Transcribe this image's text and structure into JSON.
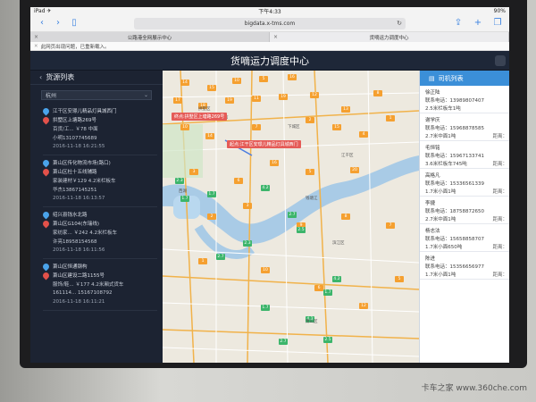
{
  "status_bar": {
    "left": "iPad ✈",
    "time": "下午4:33",
    "right": "90%"
  },
  "toolbar": {
    "url": "bigdata.x-tms.com"
  },
  "tabs": [
    {
      "label": "公路港全网展示中心",
      "active": false
    },
    {
      "label": "货嘀运力调度中心",
      "active": true
    }
  ],
  "notice": "此网页出现问题，已重新载入。",
  "app": {
    "title": "货嘀运力调度中心"
  },
  "left_panel": {
    "title": "货源列表",
    "city": "杭州",
    "items": [
      {
        "from": "江干区安璟儿精品灯具城西门",
        "to": "拱墅区上塘路269号",
        "info": "百货/工... ￥78 中面",
        "phone": "小明13107745689",
        "time": "2016-11-18 16:21:55"
      },
      {
        "from": "萧山区传化物流市场(路口)",
        "to": "萧山区杜十五线辅路",
        "info": "家装建材￥129 4.2米栏板车",
        "phone": "华杰13867145251",
        "time": "2016-11-18 16:13:57"
      },
      {
        "from": "绍兴县钱水北路",
        "to": "萧山区G104(东瑞线)",
        "info": "家纺家... ￥242 4.2米栏板车",
        "phone": "许亮18958154568",
        "time": "2016-11-18 16:11:56"
      },
      {
        "from": "萧山区恒通钢构",
        "to": "萧山区建设二路1155号",
        "info": "服饰/鞋... ￥177 4.2米厢式货车",
        "phone": "161114... 15167108792",
        "time": "2016-11-18 16:11:21"
      }
    ]
  },
  "map": {
    "callouts": [
      "终点:拱墅区上塘路269号",
      "起点:江干区安璟儿精品灯具城西门"
    ],
    "badges_orange": [
      "14",
      "15",
      "10",
      "5",
      "16",
      "17",
      "18",
      "19",
      "11",
      "19",
      "12",
      "13",
      "8",
      "10",
      "14",
      "7",
      "2",
      "15",
      "4",
      "1",
      "3",
      "6",
      "16",
      "5",
      "20",
      "2",
      "3",
      "9",
      "8",
      "7",
      "1",
      "10",
      "6",
      "12",
      "5"
    ],
    "badges_green": [
      "2.3",
      "4.2",
      "1.7",
      "1.7",
      "2.7",
      "2.5",
      "2.7",
      "2.3",
      "4.2",
      "1.7",
      "4.2",
      "1.7",
      "2.7",
      "2.5"
    ],
    "place_labels": [
      "杭州市",
      "西湖",
      "钱塘江",
      "萧山区",
      "滨江区",
      "上城区",
      "下城区",
      "江干区",
      "拱墅区"
    ]
  },
  "right_panel": {
    "title": "司机列表",
    "drivers": [
      {
        "name": "徐正陆",
        "phone": "联系电话：13989807407",
        "vehicle": "2.5米栏板车1吨",
        "distance": ""
      },
      {
        "name": "谢学庆",
        "phone": "联系电话：15968878585",
        "vehicle": "2.7米中面1吨",
        "distance": "距离："
      },
      {
        "name": "毛恒铭",
        "phone": "联系电话：15967133741",
        "vehicle": "3.6米栏板车745吨",
        "distance": "距离："
      },
      {
        "name": "高格凡",
        "phone": "联系电话：15336561339",
        "vehicle": "1.7米小面1吨",
        "distance": "距离："
      },
      {
        "name": "李捷",
        "phone": "联系电话：18758872650",
        "vehicle": "2.7米中面1吨",
        "distance": "距离："
      },
      {
        "name": "杨志法",
        "phone": "联系电话：15658858707",
        "vehicle": "1.7米小面650吨",
        "distance": "距离："
      },
      {
        "name": "陈进",
        "phone": "联系电话：15356656977",
        "vehicle": "1.7米小面1吨",
        "distance": "距离："
      }
    ]
  },
  "watermark": "卡车之家 www.360che.com"
}
